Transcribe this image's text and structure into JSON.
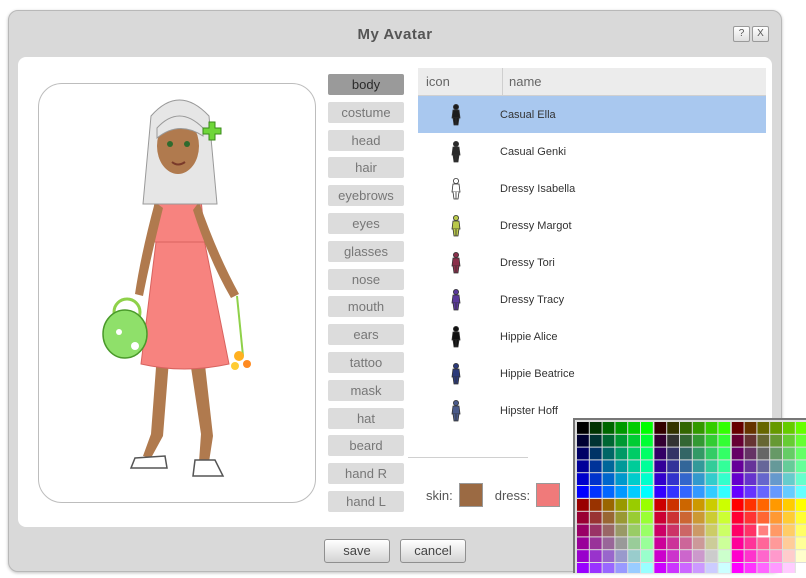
{
  "window": {
    "title": "My Avatar",
    "help_label": "?",
    "close_label": "X"
  },
  "categories": [
    "body",
    "costume",
    "head",
    "hair",
    "eyebrows",
    "eyes",
    "glasses",
    "nose",
    "mouth",
    "ears",
    "tattoo",
    "mask",
    "hat",
    "beard",
    "hand R",
    "hand L"
  ],
  "selected_category": "body",
  "list": {
    "headers": {
      "icon": "icon",
      "name": "name"
    },
    "items": [
      {
        "name": "Casual Ella",
        "color": "#1c1c1c",
        "selected": true
      },
      {
        "name": "Casual Genki",
        "color": "#2a2a2a"
      },
      {
        "name": "Dressy Isabella",
        "color": "#ffffff"
      },
      {
        "name": "Dressy Margot",
        "color": "#b9c84a"
      },
      {
        "name": "Dressy Tori",
        "color": "#8a2f4a"
      },
      {
        "name": "Dressy Tracy",
        "color": "#5a3a9a"
      },
      {
        "name": "Hippie Alice",
        "color": "#111111"
      },
      {
        "name": "Hippie Beatrice",
        "color": "#2b3a7a"
      },
      {
        "name": "Hipster Hoff",
        "color": "#4a5a8a"
      }
    ]
  },
  "colors": {
    "skin_label": "skin:",
    "skin_color": "#9b6a43",
    "dress_label": "dress:",
    "dress_color": "#f07a7a"
  },
  "buttons": {
    "save": "save",
    "cancel": "cancel"
  },
  "palette": {
    "selected_color": "#ff8080"
  }
}
